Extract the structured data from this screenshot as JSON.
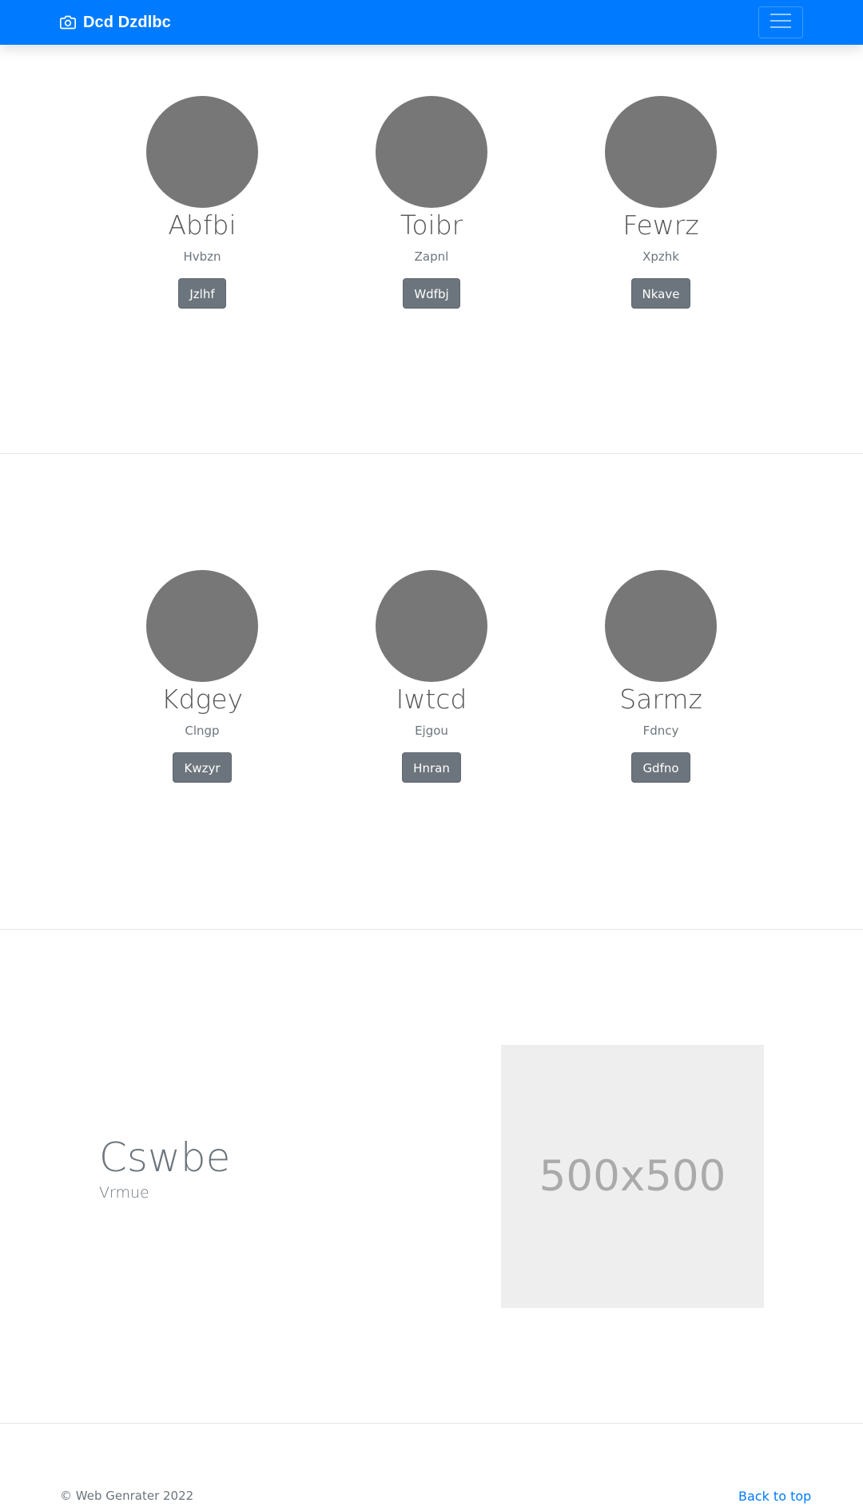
{
  "navbar": {
    "brand": "Dcd Dzdlbc",
    "brand_icon": "camera-icon",
    "toggler_icon": "hamburger-menu-icon",
    "bg_color": "#007bff"
  },
  "team_rows": [
    {
      "cards": [
        {
          "name": "Abfbi",
          "subtitle": "Hvbzn",
          "button": "Jzlhf"
        },
        {
          "name": "Toibr",
          "subtitle": "Zapnl",
          "button": "Wdfbj"
        },
        {
          "name": "Fewrz",
          "subtitle": "Xpzhk",
          "button": "Nkave"
        }
      ]
    },
    {
      "cards": [
        {
          "name": "Kdgey",
          "subtitle": "Clngp",
          "button": "Kwzyr"
        },
        {
          "name": "Iwtcd",
          "subtitle": "Ejgou",
          "button": "Hnran"
        },
        {
          "name": "Sarmz",
          "subtitle": "Fdncy",
          "button": "Gdfno"
        }
      ]
    }
  ],
  "feature": {
    "title": "Cswbe",
    "subtitle": "Vrmue",
    "placeholder_label": "500x500"
  },
  "footer": {
    "copyright": "© Web Genrater 2022",
    "back_to_top": "Back to top",
    "link_color": "#007bff"
  }
}
